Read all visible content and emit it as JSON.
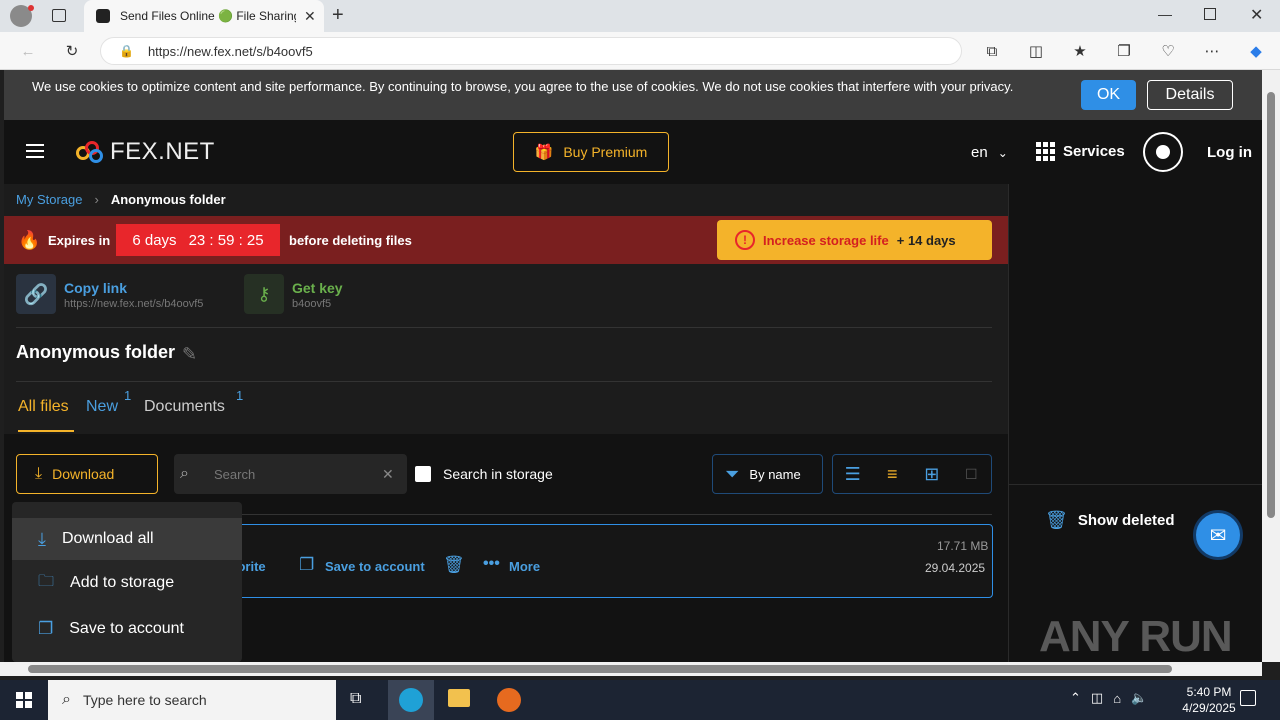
{
  "browser": {
    "tab_title": "Send Files Online 🟢 File Sharing",
    "url": "https://new.fex.net/s/b4oovf5"
  },
  "cookie": {
    "text": "We use cookies to optimize content and site performance. By continuing to browse, you agree to the use of cookies. We do not use cookies that interfere with your privacy.",
    "ok_label": "OK",
    "details_label": "Details"
  },
  "header": {
    "logo_text": "FEX.NET",
    "premium_label": "Buy Premium",
    "lang": "en",
    "services_label": "Services",
    "login_label": "Log in"
  },
  "breadcrumb": {
    "root": "My Storage",
    "current": "Anonymous folder"
  },
  "expiry": {
    "prefix": "Expires in",
    "days": "6 days",
    "time": "23 : 59 : 25",
    "suffix": "before deleting files",
    "increase_label": "Increase storage life",
    "increase_bonus": "+ 14 days"
  },
  "share": {
    "copy_link_label": "Copy link",
    "copy_link_url": "https://new.fex.net/s/b4oovf5",
    "get_key_label": "Get key",
    "key_value": "b4oovf5"
  },
  "folder": {
    "title": "Anonymous folder"
  },
  "tabs": [
    {
      "label": "All files",
      "count": ""
    },
    {
      "label": "New",
      "count": "1"
    },
    {
      "label": "Documents",
      "count": "1"
    }
  ],
  "toolbar": {
    "download_label": "Download",
    "search_placeholder": "Search",
    "search_storage_label": "Search in storage",
    "sort_label": "By name"
  },
  "dropdown": {
    "items": [
      "Download all",
      "Add to storage",
      "Save to account"
    ]
  },
  "file": {
    "favorite_label": "avorite",
    "save_label": "Save to account",
    "more_label": "More",
    "size": "17.71 MB",
    "date": "29.04.2025"
  },
  "right": {
    "show_deleted_label": "Show deleted"
  },
  "watermark": "ANY RUN",
  "taskbar": {
    "search_placeholder": "Type here to search",
    "time": "5:40 PM",
    "date": "4/29/2025"
  },
  "colors": {
    "accent_yellow": "#f4b32a",
    "link_blue": "#4a9fe0",
    "expiry_red": "#7a1f1f",
    "timer_red": "#e8262b",
    "green": "#6ab04c"
  }
}
